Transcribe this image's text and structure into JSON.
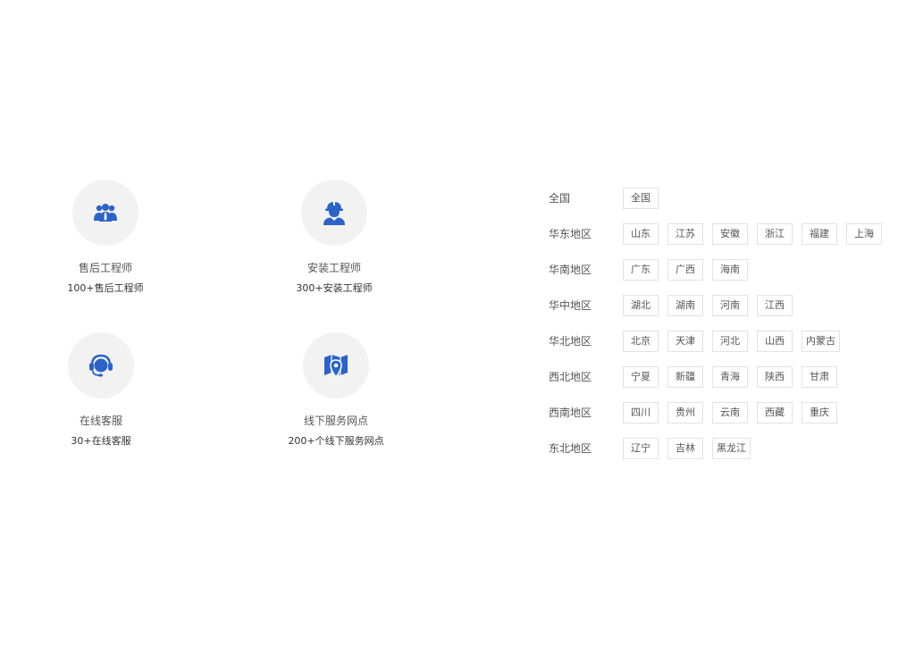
{
  "services": [
    {
      "icon": "engineer-group-icon",
      "title": "售后工程师",
      "desc": "100+售后工程师"
    },
    {
      "icon": "installer-worker-icon",
      "title": "安装工程师",
      "desc": "300+安装工程师"
    },
    {
      "icon": "customer-service-headset-icon",
      "title": "在线客服",
      "desc": "30+在线客服"
    },
    {
      "icon": "map-pin-icon",
      "title": "线下服务网点",
      "desc": "200+个线下服务网点"
    }
  ],
  "colors": {
    "icon_blue": "#2b63c8",
    "circle_bg": "#f2f2f2",
    "chip_border": "#e2e2e2"
  },
  "regions": [
    {
      "label": "全国",
      "items": [
        "全国"
      ]
    },
    {
      "label": "华东地区",
      "items": [
        "山东",
        "江苏",
        "安徽",
        "浙江",
        "福建",
        "上海"
      ]
    },
    {
      "label": "华南地区",
      "items": [
        "广东",
        "广西",
        "海南"
      ]
    },
    {
      "label": "华中地区",
      "items": [
        "湖北",
        "湖南",
        "河南",
        "江西"
      ]
    },
    {
      "label": "华北地区",
      "items": [
        "北京",
        "天津",
        "河北",
        "山西",
        "内蒙古"
      ]
    },
    {
      "label": "西北地区",
      "items": [
        "宁夏",
        "新疆",
        "青海",
        "陕西",
        "甘肃"
      ]
    },
    {
      "label": "西南地区",
      "items": [
        "四川",
        "贵州",
        "云南",
        "西藏",
        "重庆"
      ]
    },
    {
      "label": "东北地区",
      "items": [
        "辽宁",
        "吉林",
        "黑龙江"
      ]
    }
  ]
}
